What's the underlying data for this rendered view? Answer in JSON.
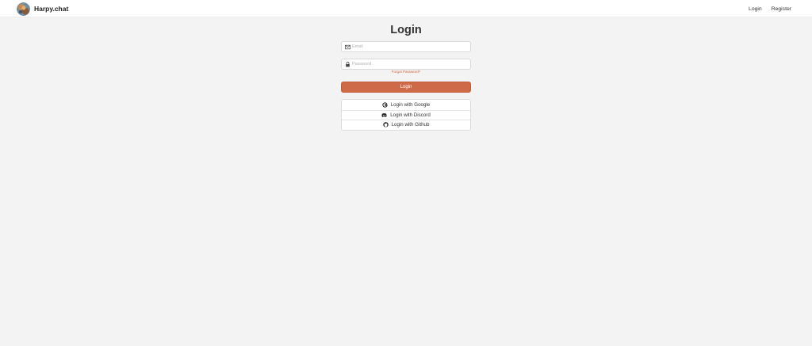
{
  "nav": {
    "brand": "Harpy.chat",
    "links": {
      "login": "Login",
      "register": "Register"
    }
  },
  "form": {
    "title": "Login",
    "email_placeholder": "Email",
    "password_placeholder": "Password",
    "forgot_label": "Forgot Password?",
    "submit_label": "Login"
  },
  "oauth": {
    "google": "Login with Google",
    "discord": "Login with Discord",
    "github": "Login with Github"
  },
  "colors": {
    "accent": "#cf6a49",
    "link": "#d0643f",
    "page_background": "#f3f3f3"
  },
  "icons": [
    "brand-avatar",
    "mail-icon",
    "lock-icon",
    "google-icon",
    "discord-icon",
    "github-icon"
  ]
}
